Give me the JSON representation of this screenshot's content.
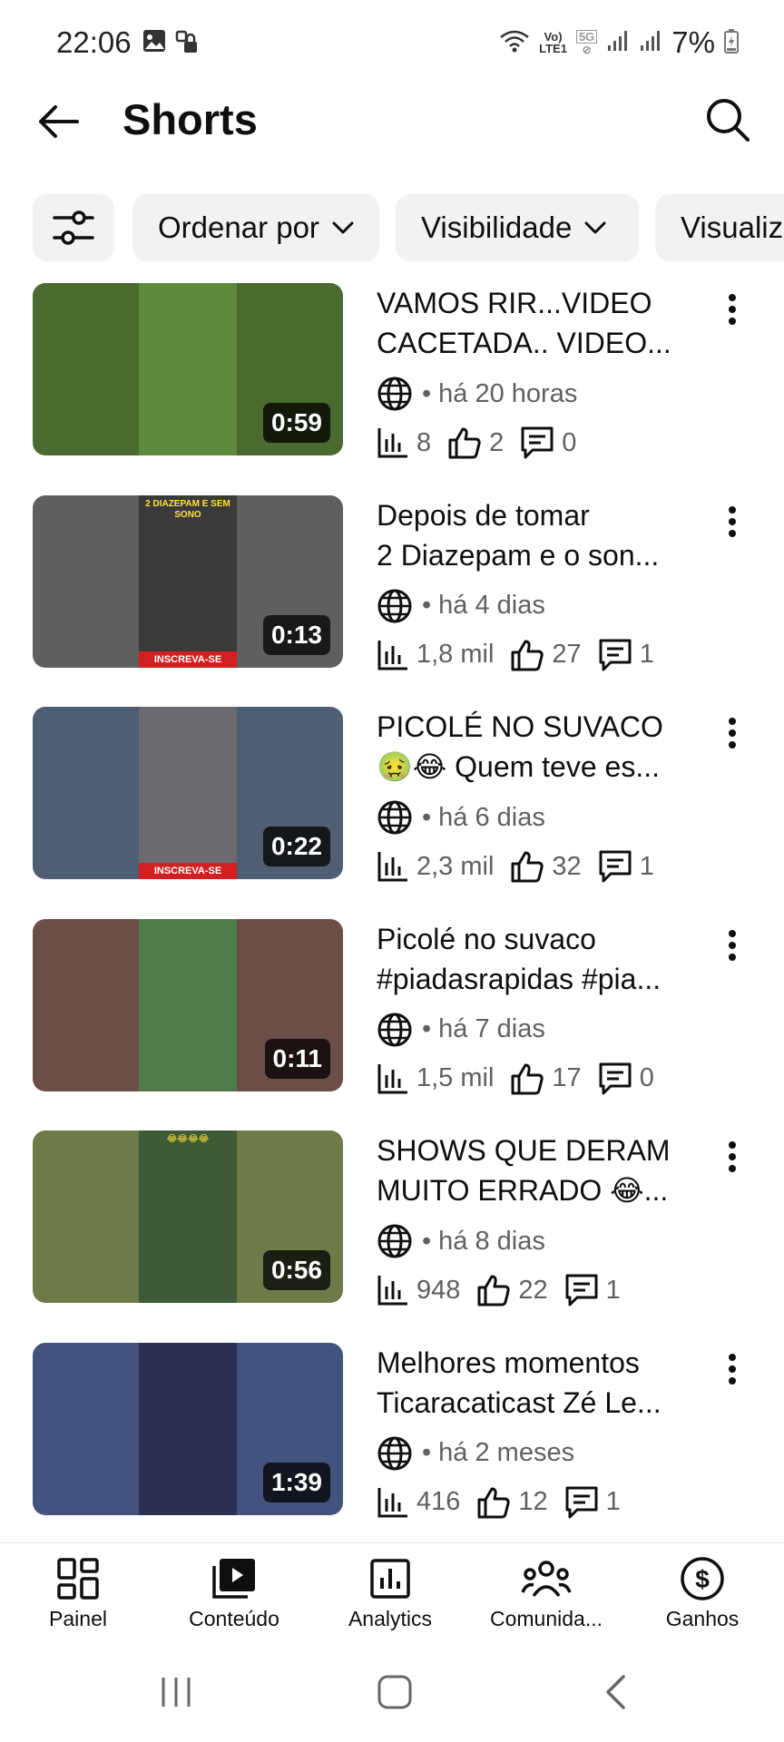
{
  "status_bar": {
    "time": "22:06",
    "network_volte": "Vo)",
    "network_lte": "LTE1",
    "network_5g": "5G",
    "battery": "7%"
  },
  "header": {
    "title": "Shorts"
  },
  "filters": {
    "sort_label": "Ordenar por",
    "visibility_label": "Visibilidade",
    "views_label": "Visualiz"
  },
  "videos": [
    {
      "title_line1": "VAMOS RIR...VIDEO",
      "title_line2": "CACETADA.. VIDEO...",
      "age": "há 20 horas",
      "views": "8",
      "likes": "2",
      "comments": "0",
      "duration": "0:59",
      "thumb_color": "#4a6b2f",
      "thumb_center": "#5e8a3c"
    },
    {
      "title_line1": "Depois de tomar",
      "title_line2": "2 Diazepam e o son...",
      "age": "há 4 dias",
      "views": "1,8 mil",
      "likes": "27",
      "comments": "1",
      "duration": "0:13",
      "thumb_color": "#5f5f5f",
      "thumb_center": "#3a3a3a",
      "thumb_caption": "2 DIAZEPAM E SEM SONO",
      "thumb_badge": "INSCREVA-SE"
    },
    {
      "title_line1": "PICOLÉ NO SUVACO",
      "title_line2": "🤢😂 Quem teve es...",
      "age": "há 6 dias",
      "views": "2,3 mil",
      "likes": "32",
      "comments": "1",
      "duration": "0:22",
      "thumb_color": "#4f5e72",
      "thumb_center": "#6a6a70",
      "thumb_badge": "INSCREVA-SE"
    },
    {
      "title_line1": "Picolé no suvaco",
      "title_line2": "#piadasrapidas #pia...",
      "age": "há 7 dias",
      "views": "1,5 mil",
      "likes": "17",
      "comments": "0",
      "duration": "0:11",
      "thumb_color": "#6b4e48",
      "thumb_center": "#4f7a4a"
    },
    {
      "title_line1": "SHOWS QUE DERAM",
      "title_line2": "MUITO ERRADO 😂...",
      "age": "há 8 dias",
      "views": "948",
      "likes": "22",
      "comments": "1",
      "duration": "0:56",
      "thumb_color": "#6e7a48",
      "thumb_center": "#3f5a36",
      "thumb_caption": "😂😂😂😂"
    },
    {
      "title_line1": "Melhores momentos",
      "title_line2": "Ticaracaticast Zé Le...",
      "age": "há 2 meses",
      "views": "416",
      "likes": "12",
      "comments": "1",
      "duration": "1:39",
      "thumb_color": "#42537e",
      "thumb_center": "#2b2f52"
    }
  ],
  "bottom_nav": {
    "items": [
      {
        "label": "Painel",
        "icon": "dashboard-icon"
      },
      {
        "label": "Conteúdo",
        "icon": "content-icon"
      },
      {
        "label": "Analytics",
        "icon": "analytics-icon"
      },
      {
        "label": "Comunida...",
        "icon": "community-icon"
      },
      {
        "label": "Ganhos",
        "icon": "earnings-icon"
      }
    ]
  }
}
